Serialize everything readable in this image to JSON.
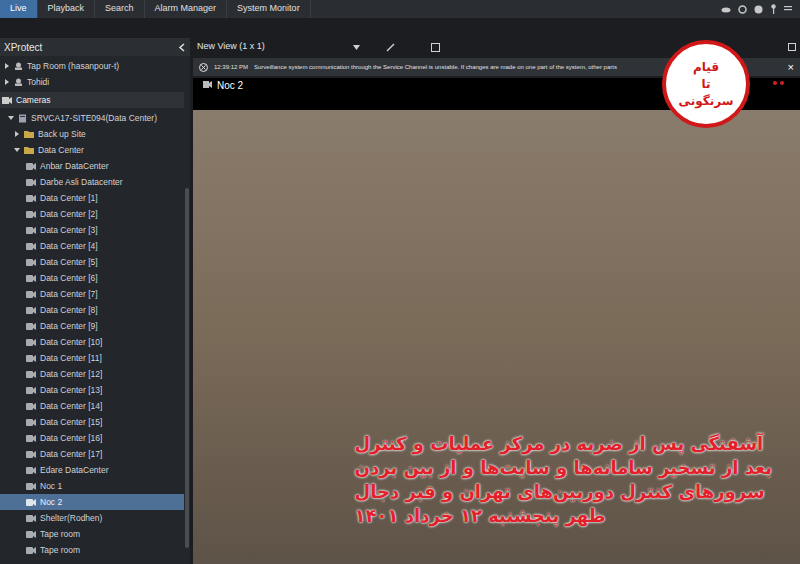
{
  "tabs": [
    {
      "label": "Live",
      "selected": true
    },
    {
      "label": "Playback",
      "selected": false
    },
    {
      "label": "Search",
      "selected": false
    },
    {
      "label": "Alarm Manager",
      "selected": false
    },
    {
      "label": "System Monitor",
      "selected": false
    }
  ],
  "sidebar": {
    "title": "XProtect",
    "items": [
      {
        "label": "Tap Room (hasanpour-t)",
        "kind": "group",
        "expanded": false,
        "selected": false
      },
      {
        "label": "Tohidi",
        "kind": "group",
        "expanded": false,
        "selected": false
      },
      {
        "label": "Cameras",
        "kind": "section",
        "expanded": true,
        "selected": false
      },
      {
        "label": "SRVCA17-SITE094(Data Center)",
        "kind": "server",
        "expanded": true,
        "selected": false
      },
      {
        "label": "Back up Site",
        "kind": "folder",
        "expanded": false,
        "selected": false
      },
      {
        "label": "Data Center",
        "kind": "folder",
        "expanded": true,
        "selected": false
      },
      {
        "label": "Anbar DataCenter",
        "kind": "camera",
        "expanded": false,
        "selected": false
      },
      {
        "label": "Darbe Asli Datacenter",
        "kind": "camera",
        "expanded": false,
        "selected": false
      },
      {
        "label": "Data Center [1]",
        "kind": "camera",
        "expanded": false,
        "selected": false
      },
      {
        "label": "Data Center [2]",
        "kind": "camera",
        "expanded": false,
        "selected": false
      },
      {
        "label": "Data Center [3]",
        "kind": "camera",
        "expanded": false,
        "selected": false
      },
      {
        "label": "Data Center [4]",
        "kind": "camera",
        "expanded": false,
        "selected": false
      },
      {
        "label": "Data Center [5]",
        "kind": "camera",
        "expanded": false,
        "selected": false
      },
      {
        "label": "Data Center [6]",
        "kind": "camera",
        "expanded": false,
        "selected": false
      },
      {
        "label": "Data Center [7]",
        "kind": "camera",
        "expanded": false,
        "selected": false
      },
      {
        "label": "Data Center [8]",
        "kind": "camera",
        "expanded": false,
        "selected": false
      },
      {
        "label": "Data Center [9]",
        "kind": "camera",
        "expanded": false,
        "selected": false
      },
      {
        "label": "Data Center [10]",
        "kind": "camera",
        "expanded": false,
        "selected": false
      },
      {
        "label": "Data Center [11]",
        "kind": "camera",
        "expanded": false,
        "selected": false
      },
      {
        "label": "Data Center [12]",
        "kind": "camera",
        "expanded": false,
        "selected": false
      },
      {
        "label": "Data Center [13]",
        "kind": "camera",
        "expanded": false,
        "selected": false
      },
      {
        "label": "Data Center [14]",
        "kind": "camera",
        "expanded": false,
        "selected": false
      },
      {
        "label": "Data Center [15]",
        "kind": "camera",
        "expanded": false,
        "selected": false
      },
      {
        "label": "Data Center [16]",
        "kind": "camera",
        "expanded": false,
        "selected": false
      },
      {
        "label": "Data Center [17]",
        "kind": "camera",
        "expanded": false,
        "selected": false
      },
      {
        "label": "Edare DataCenter",
        "kind": "camera",
        "expanded": false,
        "selected": false
      },
      {
        "label": "Noc 1",
        "kind": "camera",
        "expanded": false,
        "selected": false
      },
      {
        "label": "Noc 2",
        "kind": "camera",
        "expanded": false,
        "selected": true
      },
      {
        "label": "Shelter(Rodhen)",
        "kind": "camera",
        "expanded": false,
        "selected": false
      },
      {
        "label": "Tape room",
        "kind": "camera",
        "expanded": false,
        "selected": false
      },
      {
        "label": "Tape room",
        "kind": "camera",
        "expanded": false,
        "selected": false
      }
    ]
  },
  "view": {
    "title": "New View (1 x 1)"
  },
  "notification": {
    "time": "12:39:12 PM",
    "message": "Surveillance system communication through the Service Channel is unstable. If changes are made on one part of the system, other parts",
    "close": "×"
  },
  "camera": {
    "title": "Noc 2"
  },
  "overlay": {
    "badge": [
      "قیام",
      "تا",
      "سرنگونی"
    ],
    "caption": [
      "آشفتگی پس از ضربه در مرکز عملیات و کنترل",
      "بعد از تسخیر سامانه‌ها و سایت‌ها و از بین بردن",
      "سرورهای کنترل دوربین‌های تهران و قبر دجال",
      "ظهر پنجشنبه ۱۲ خرداد ۱۴۰۱"
    ]
  }
}
